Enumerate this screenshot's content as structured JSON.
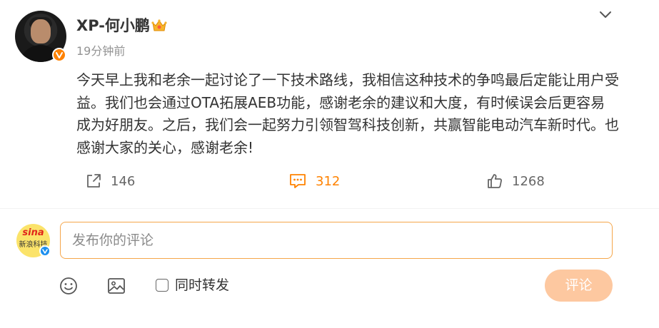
{
  "post": {
    "author": "XP-何小鹏",
    "time": "19分钟前",
    "text": "今天早上我和老余一起讨论了一下技术路线，我相信这种技术的争鸣最后定能让用户受益。我们也会通过OTA拓展AEB功能，感谢老余的建议和大度，有时候误会后更容易成为好朋友。之后，我们会一起努力引领智驾科技创新，共赢智能电动汽车新时代。也感谢大家的关心，感谢老余!",
    "actions": {
      "share_count": "146",
      "comment_count": "312",
      "like_count": "1268"
    }
  },
  "composer": {
    "avatar_logo": "sina",
    "avatar_sub": "新浪科技",
    "placeholder": "发布你的评论",
    "repost_label": "同时转发",
    "repost_checked": false,
    "submit_label": "评论"
  },
  "colors": {
    "accent": "#ff8200",
    "input_border": "#f5a64a",
    "submit_bg": "#fdc8a0",
    "muted": "#939393"
  },
  "icons": {
    "verified_badge": "verified-badge-icon",
    "crown": "crown-icon",
    "expand": "chevron-down-icon",
    "share": "share-icon",
    "comment": "comment-icon",
    "like": "thumbs-up-icon",
    "emoji": "emoji-icon",
    "image": "image-icon"
  }
}
